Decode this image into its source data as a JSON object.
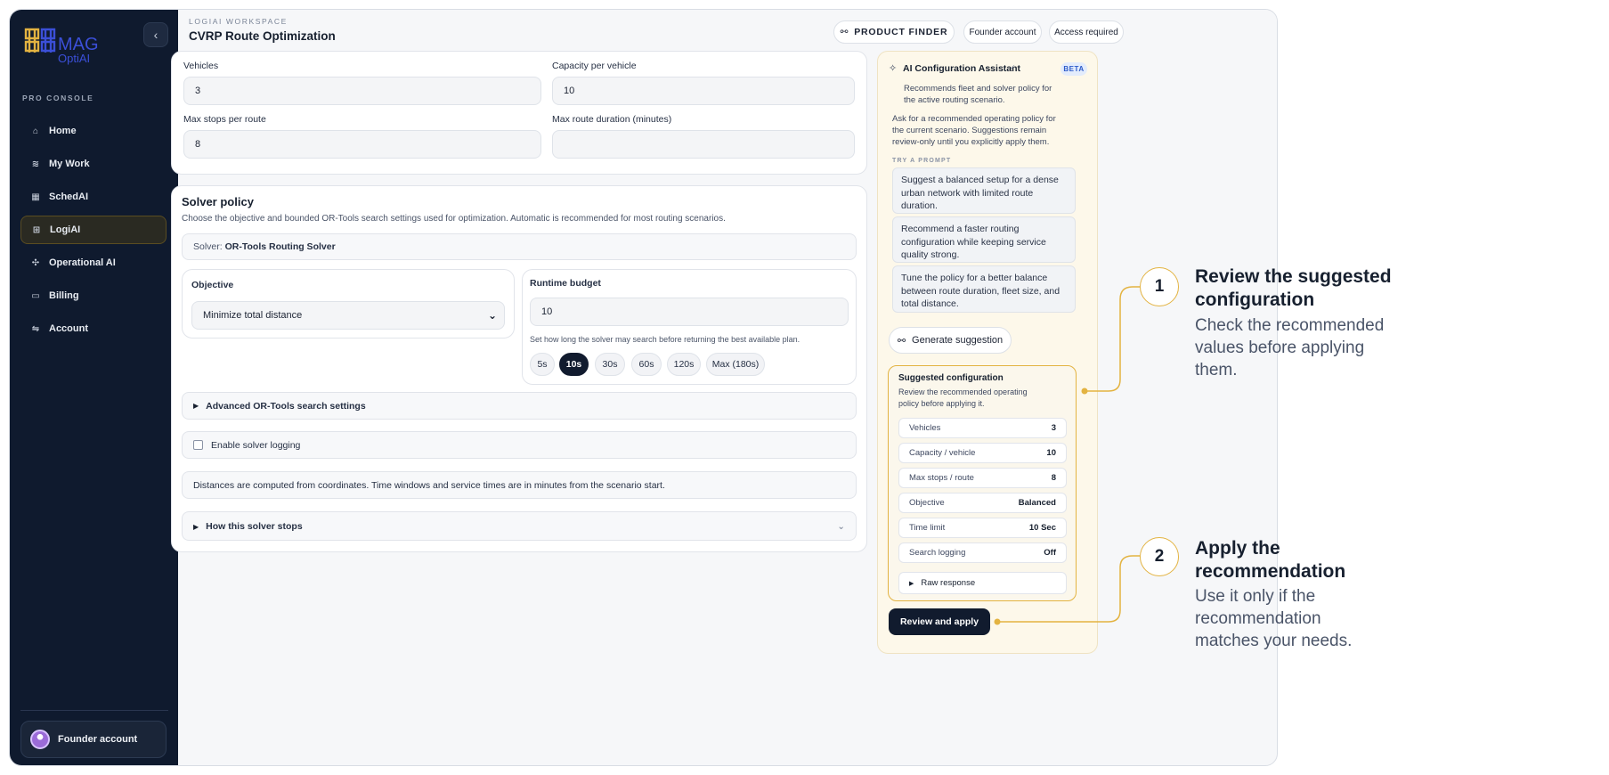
{
  "sidebar": {
    "logo_text_top": "MAG",
    "logo_text_bottom": "OptiAI",
    "section_label": "PRO CONSOLE",
    "items": [
      {
        "label": "Home",
        "icon": "home-icon"
      },
      {
        "label": "My Work",
        "icon": "layers-icon"
      },
      {
        "label": "SchedAI",
        "icon": "calendar-icon"
      },
      {
        "label": "LogiAI",
        "icon": "route-icon"
      },
      {
        "label": "Operational AI",
        "icon": "ops-icon"
      },
      {
        "label": "Billing",
        "icon": "card-icon"
      },
      {
        "label": "Account",
        "icon": "sliders-icon"
      }
    ],
    "active": "LogiAI",
    "founder_label": "Founder account"
  },
  "header": {
    "workspace_label": "LOGIAI WORKSPACE",
    "title": "CVRP Route Optimization",
    "product_finder": "PRODUCT FINDER",
    "founder_account": "Founder account",
    "access_required": "Access required"
  },
  "fleet": {
    "vehicles_label": "Vehicles",
    "vehicles_value": "3",
    "capacity_label": "Capacity per vehicle",
    "capacity_value": "10",
    "max_stops_label": "Max stops per route",
    "max_stops_value": "8",
    "max_duration_label": "Max route duration (minutes)",
    "max_duration_value": ""
  },
  "solver": {
    "title": "Solver policy",
    "description": "Choose the objective and bounded OR-Tools search settings used for optimization. Automatic is recommended for most routing scenarios.",
    "solver_prefix": "Solver:",
    "solver_name": "OR-Tools Routing Solver",
    "objective_label": "Objective",
    "objective_value": "Minimize total distance",
    "runtime_label": "Runtime budget",
    "runtime_value": "10",
    "runtime_hint": "Set how long the solver may search before returning the best available plan.",
    "runtime_chips": [
      "5s",
      "10s",
      "30s",
      "60s",
      "120s",
      "Max (180s)"
    ],
    "runtime_selected": "10s",
    "advanced_label": "Advanced OR-Tools search settings",
    "logging_label": "Enable solver logging",
    "note": "Distances are computed from coordinates. Time windows and service times are in minutes from the scenario start.",
    "stops_label": "How this solver stops"
  },
  "assistant": {
    "title": "AI Configuration Assistant",
    "beta": "BETA",
    "subtitle_1": "Recommends fleet and solver policy for",
    "subtitle_2": "the active routing scenario.",
    "intro_1": "Ask for a recommended operating policy for",
    "intro_2": "the current scenario. Suggestions remain",
    "intro_3": "review-only until you explicitly apply them.",
    "try_label": "TRY A PROMPT",
    "prompts": [
      "Suggest a balanced setup for a dense urban network with limited route duration.",
      "Recommend a faster routing configuration while keeping service quality strong.",
      "Tune the policy for a better balance between route duration, fleet size, and total distance."
    ],
    "generate_label": "Generate suggestion",
    "suggested_title": "Suggested configuration",
    "suggested_desc_1": "Review the recommended operating",
    "suggested_desc_2": "policy before applying it.",
    "rows": [
      {
        "k": "Vehicles",
        "v": "3"
      },
      {
        "k": "Capacity / vehicle",
        "v": "10"
      },
      {
        "k": "Max stops / route",
        "v": "8"
      },
      {
        "k": "Objective",
        "v": "Balanced"
      },
      {
        "k": "Time limit",
        "v": "10 Sec"
      },
      {
        "k": "Search logging",
        "v": "Off"
      }
    ],
    "raw_response": "Raw response",
    "apply_label": "Review and apply"
  },
  "callouts": [
    {
      "num": "1",
      "title_1": "Review the suggested",
      "title_2": "configuration",
      "body_1": "Check the recommended",
      "body_2": "values before applying",
      "body_3": "them."
    },
    {
      "num": "2",
      "title_1": "Apply the",
      "title_2": "recommendation",
      "body_1": "Use it only if the",
      "body_2": "recommendation",
      "body_3": "matches your needs."
    }
  ],
  "colors": {
    "accent": "#e3b341",
    "sidebar": "#0f1a2e",
    "primary": "#111b2e",
    "panel": "#fdf8ea"
  }
}
